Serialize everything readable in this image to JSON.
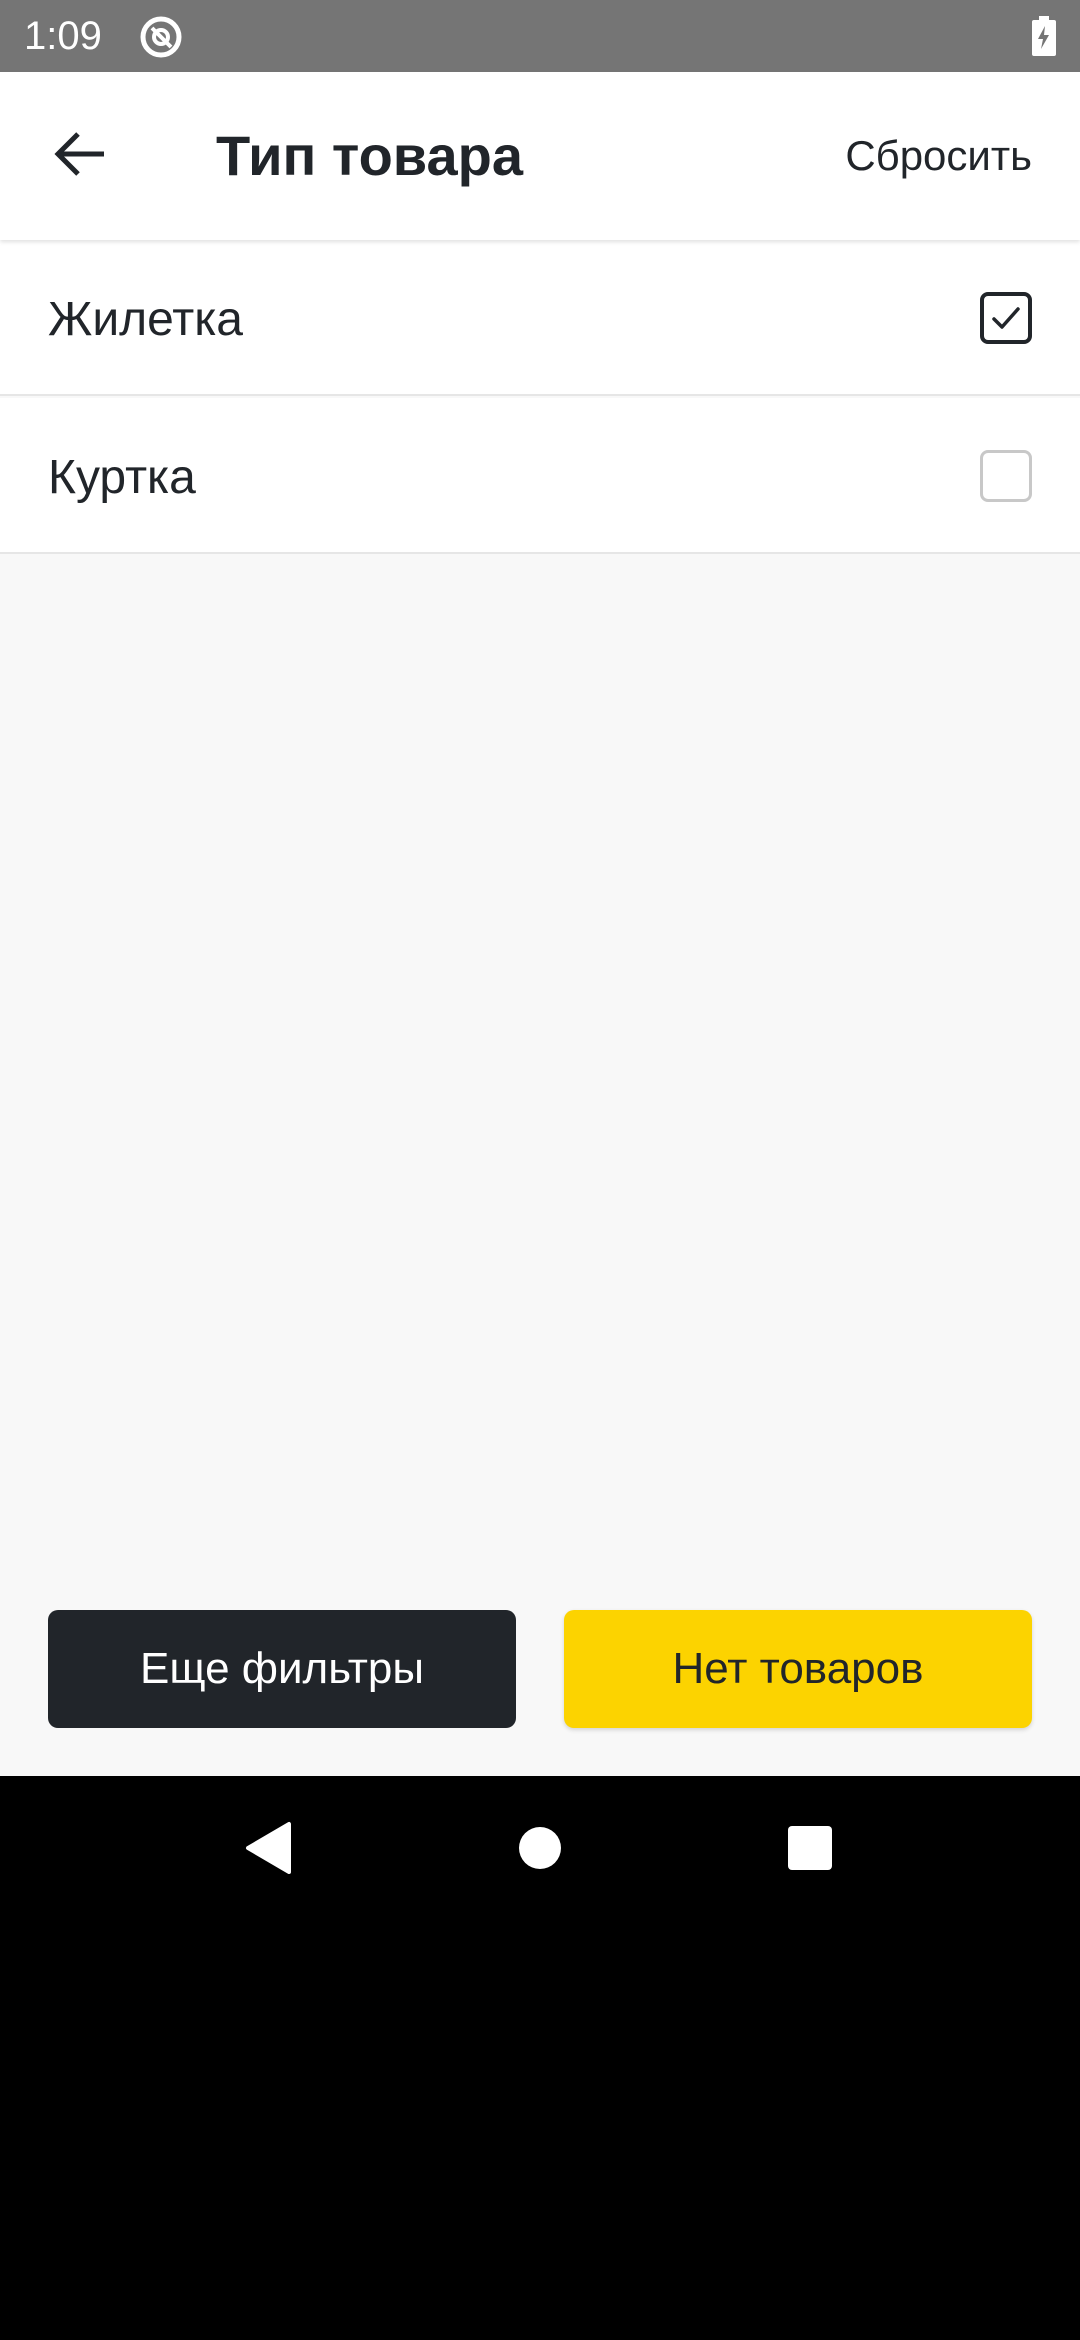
{
  "status_bar": {
    "time": "1:09",
    "app_icon": "at-sign-icon",
    "battery_icon": "battery-charging-icon"
  },
  "header": {
    "back_icon": "arrow-left-icon",
    "title": "Тип товара",
    "reset_label": "Сбросить"
  },
  "options": [
    {
      "label": "Жилетка",
      "checked": true
    },
    {
      "label": "Куртка",
      "checked": false
    }
  ],
  "footer": {
    "more_filters_label": "Еще фильтры",
    "results_label": "Нет товаров"
  },
  "nav_bar": {
    "back_icon": "triangle-back-icon",
    "home_icon": "circle-home-icon",
    "recents_icon": "square-recents-icon"
  },
  "colors": {
    "accent": "#fcd300",
    "dark": "#21252a",
    "status_bar": "#757575",
    "background": "#f8f8f8"
  }
}
